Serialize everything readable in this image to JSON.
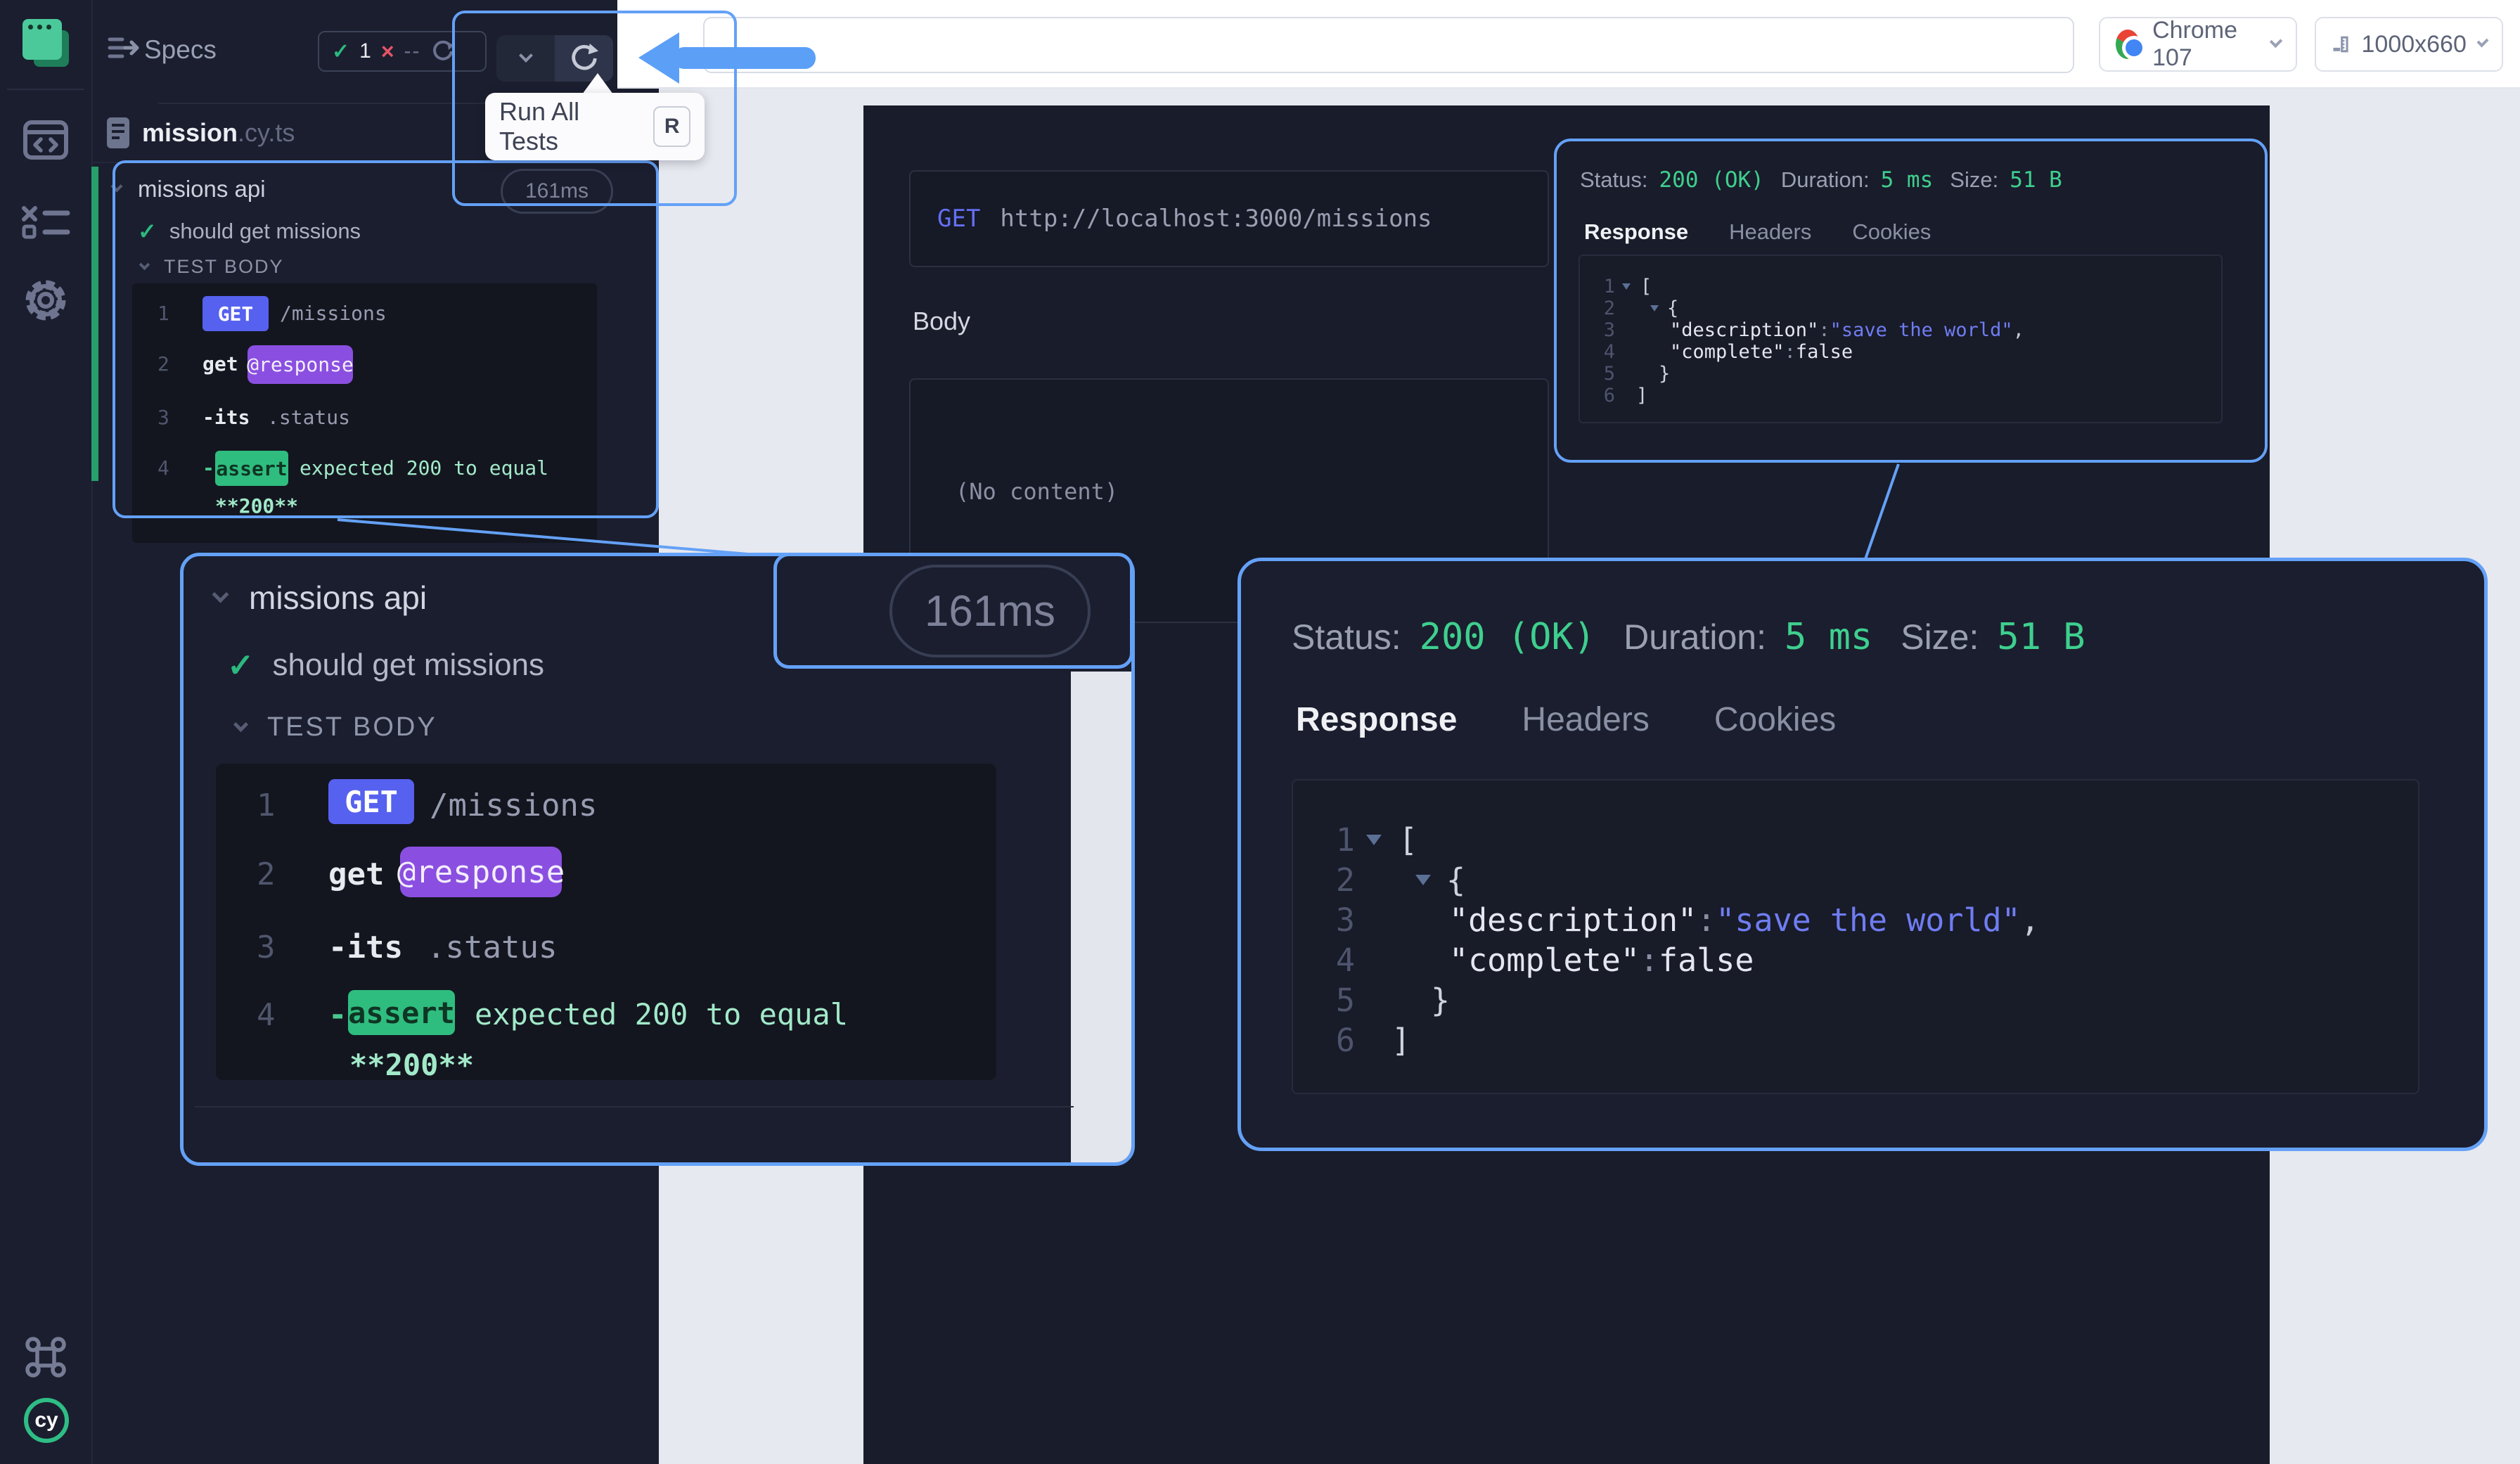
{
  "topbar": {
    "url_value": "",
    "browser": {
      "label": "Chrome 107"
    },
    "viewport": {
      "label": "1000x660"
    }
  },
  "toolbar": {
    "tooltip_label": "Run All Tests",
    "tooltip_key": "R"
  },
  "specs": {
    "title": "Specs",
    "stats": {
      "passed": "1",
      "failed": "--"
    },
    "file": {
      "name": "mission",
      "ext": ".cy.ts"
    }
  },
  "tree": {
    "suite": "missions api",
    "duration": "161ms",
    "test": "should get missions",
    "section": "TEST BODY",
    "lines": [
      {
        "num": "1",
        "badge": "GET",
        "text": "/missions"
      },
      {
        "num": "2",
        "keyword": "get",
        "badge": "@response"
      },
      {
        "num": "3",
        "keyword": "-its",
        "text": ".status"
      },
      {
        "num": "4",
        "dash": "-",
        "badge": "assert",
        "text": "expected 200 to equal",
        "wrap": "**200**"
      }
    ]
  },
  "request": {
    "method": "GET",
    "url": "http://localhost:3000/missions",
    "body_label": "Body",
    "body_empty": "(No content)"
  },
  "response": {
    "status_label": "Status:",
    "status_value": "200 (OK)",
    "duration_label": "Duration:",
    "duration_value": "5 ms",
    "size_label": "Size:",
    "size_value": "51 B",
    "tabs": [
      {
        "label": "Response"
      },
      {
        "label": "Headers"
      },
      {
        "label": "Cookies"
      }
    ],
    "json": [
      {
        "num": "1",
        "open": "["
      },
      {
        "num": "2",
        "open": "{"
      },
      {
        "num": "3",
        "key": "\"description\"",
        "sep": ": ",
        "value": "\"save the world\"",
        "comma": ","
      },
      {
        "num": "4",
        "key": "\"complete\"",
        "sep": ": ",
        "value": "false"
      },
      {
        "num": "5",
        "close": "}"
      },
      {
        "num": "6",
        "close": "]"
      }
    ]
  },
  "icons": {
    "rail": [
      "cypress-app-logo",
      "browser-code-icon",
      "test-list-icon",
      "settings-gear-icon",
      "keyboard-shortcuts-icon",
      "cypress-cy-logo"
    ],
    "colors": {
      "accent_blue": "#64a1f7",
      "green": "#2cb87f",
      "purple": "#8a4fe0",
      "method_blue": "#5661ef",
      "red": "#e45468"
    }
  }
}
